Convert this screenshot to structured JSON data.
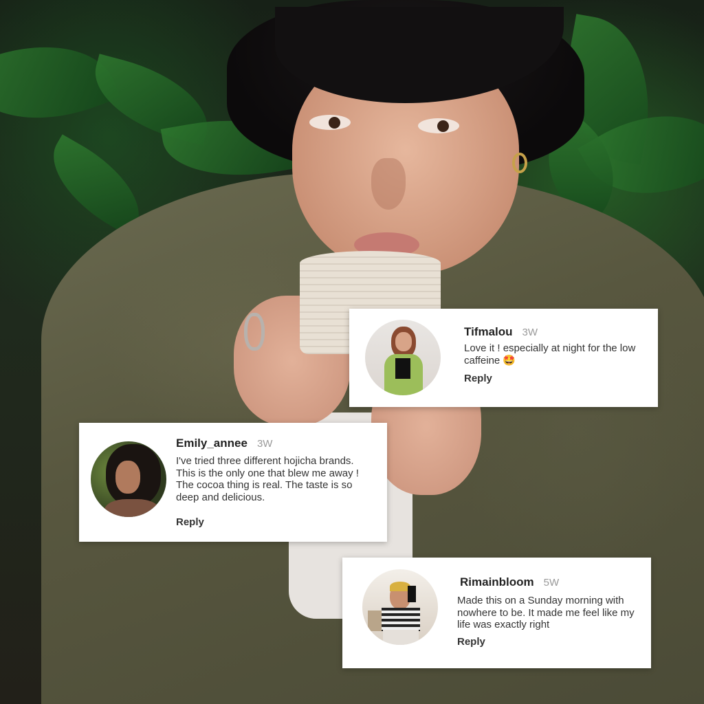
{
  "comments": [
    {
      "username": "Tifmalou",
      "age": "3W",
      "text": "Love it ! especially at night for the low caffeine 🤩",
      "reply_label": "Reply",
      "avatar_icon": "profile-photo"
    },
    {
      "username": "Emily_annee",
      "age": "3W",
      "text": "I've tried three different hojicha brands. This is the only one that blew me away !  The cocoa thing is real. The taste is so deep and delicious.",
      "reply_label": "Reply",
      "avatar_icon": "profile-photo"
    },
    {
      "username": "Rimainbloom",
      "age": "5W",
      "text": "Made this on a Sunday morning with nowhere to be. It made me feel like my life was exactly right",
      "reply_label": "Reply",
      "avatar_icon": "profile-photo"
    }
  ],
  "colors": {
    "card_background": "#ffffff",
    "username": "#222222",
    "timestamp": "#999999",
    "body_text": "#333333"
  }
}
